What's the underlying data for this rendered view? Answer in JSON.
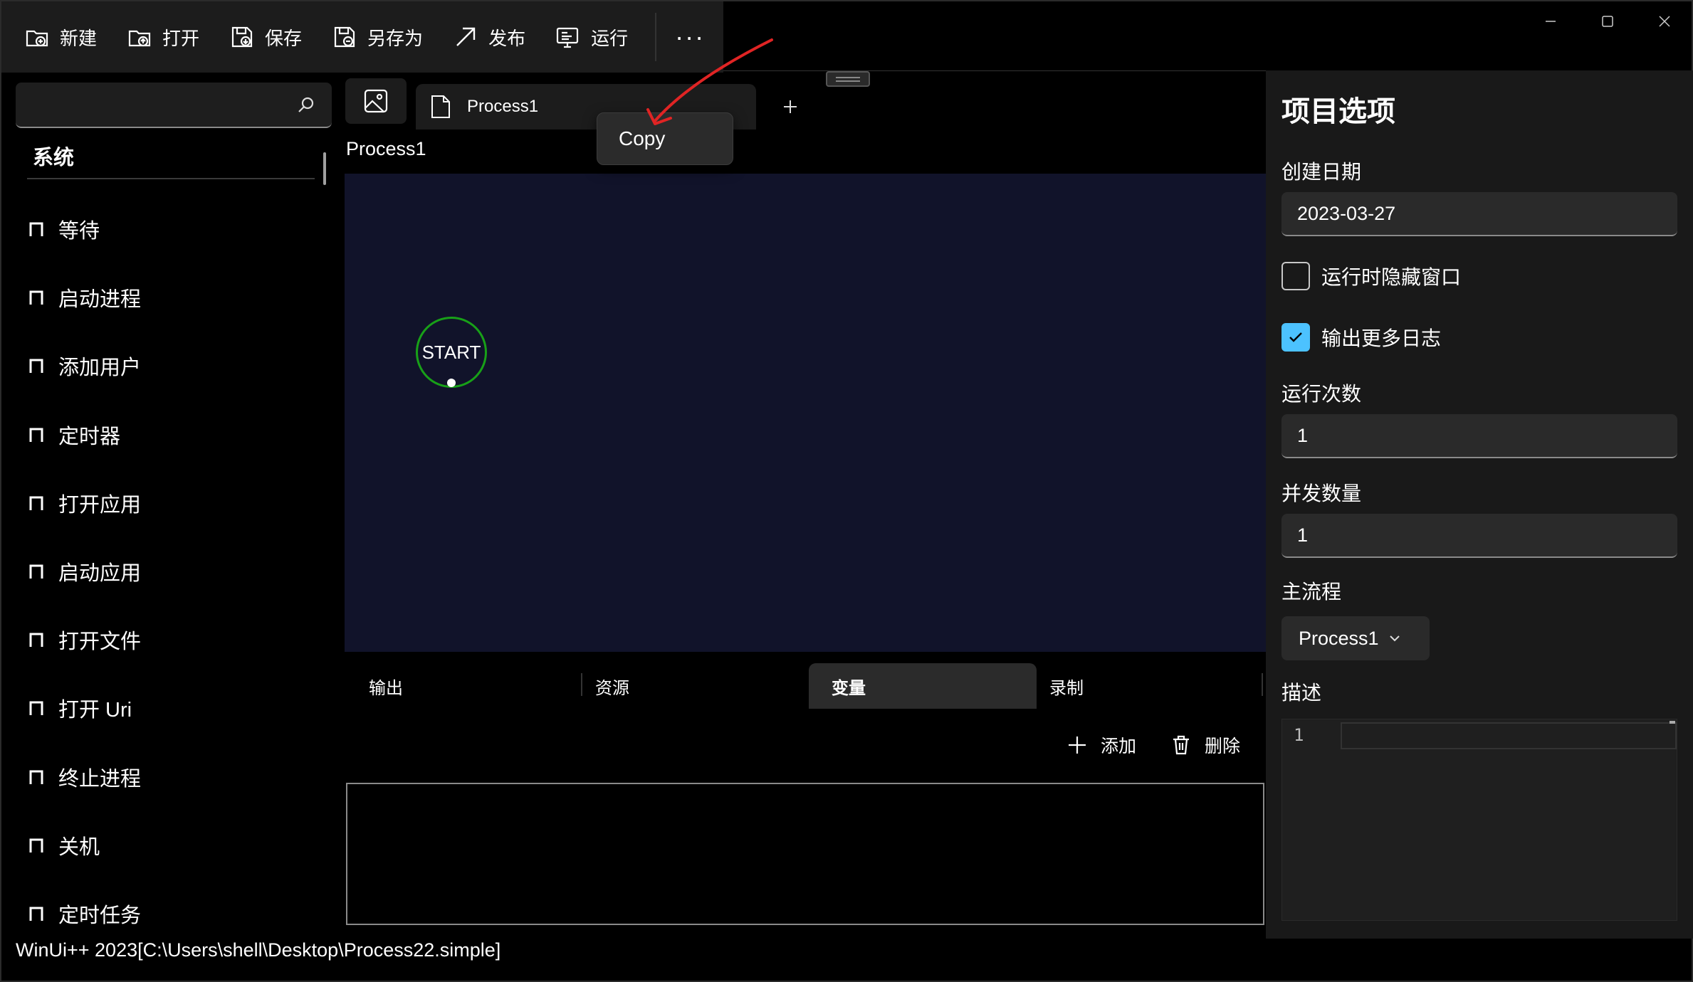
{
  "toolbar": {
    "buttons": [
      {
        "label": "新建",
        "icon": "new-file-icon"
      },
      {
        "label": "打开",
        "icon": "open-folder-icon"
      },
      {
        "label": "保存",
        "icon": "save-icon"
      },
      {
        "label": "另存为",
        "icon": "save-as-icon"
      },
      {
        "label": "发布",
        "icon": "publish-arrow-icon"
      },
      {
        "label": "运行",
        "icon": "run-monitor-icon"
      }
    ],
    "more": "···"
  },
  "window_controls": [
    "minimize-icon",
    "maximize-icon",
    "close-icon"
  ],
  "sidebar": {
    "search_placeholder": "",
    "category": "系统",
    "items": [
      "等待",
      "启动进程",
      "添加用户",
      "定时器",
      "打开应用",
      "启动应用",
      "打开文件",
      "打开 Uri",
      "终止进程",
      "关机",
      "定时任务"
    ]
  },
  "tabs": {
    "active_tab": "Process1",
    "add": "+"
  },
  "context_menu": {
    "item": "Copy"
  },
  "canvas": {
    "title": "Process1",
    "start_node": "START",
    "background": "#11132a",
    "node_border": "#18a018"
  },
  "bottom_panel": {
    "tabs": [
      "输出",
      "资源",
      "变量",
      "录制"
    ],
    "active_tab": "变量",
    "add_label": "添加",
    "delete_label": "删除"
  },
  "status_bar": "WinUi++ 2023[C:\\Users\\shell\\Desktop\\Process22.simple]",
  "properties": {
    "title": "项目选项",
    "created_label": "创建日期",
    "created_value": "2023-03-27",
    "hide_window_label": "运行时隐藏窗口",
    "hide_window_checked": false,
    "verbose_log_label": "输出更多日志",
    "verbose_log_checked": true,
    "run_count_label": "运行次数",
    "run_count_value": "1",
    "concurrency_label": "并发数量",
    "concurrency_value": "1",
    "main_flow_label": "主流程",
    "main_flow_value": "Process1",
    "description_label": "描述",
    "editor_line": "1"
  },
  "colors": {
    "accent": "#4cc2ff",
    "annotation": "#e02424"
  }
}
